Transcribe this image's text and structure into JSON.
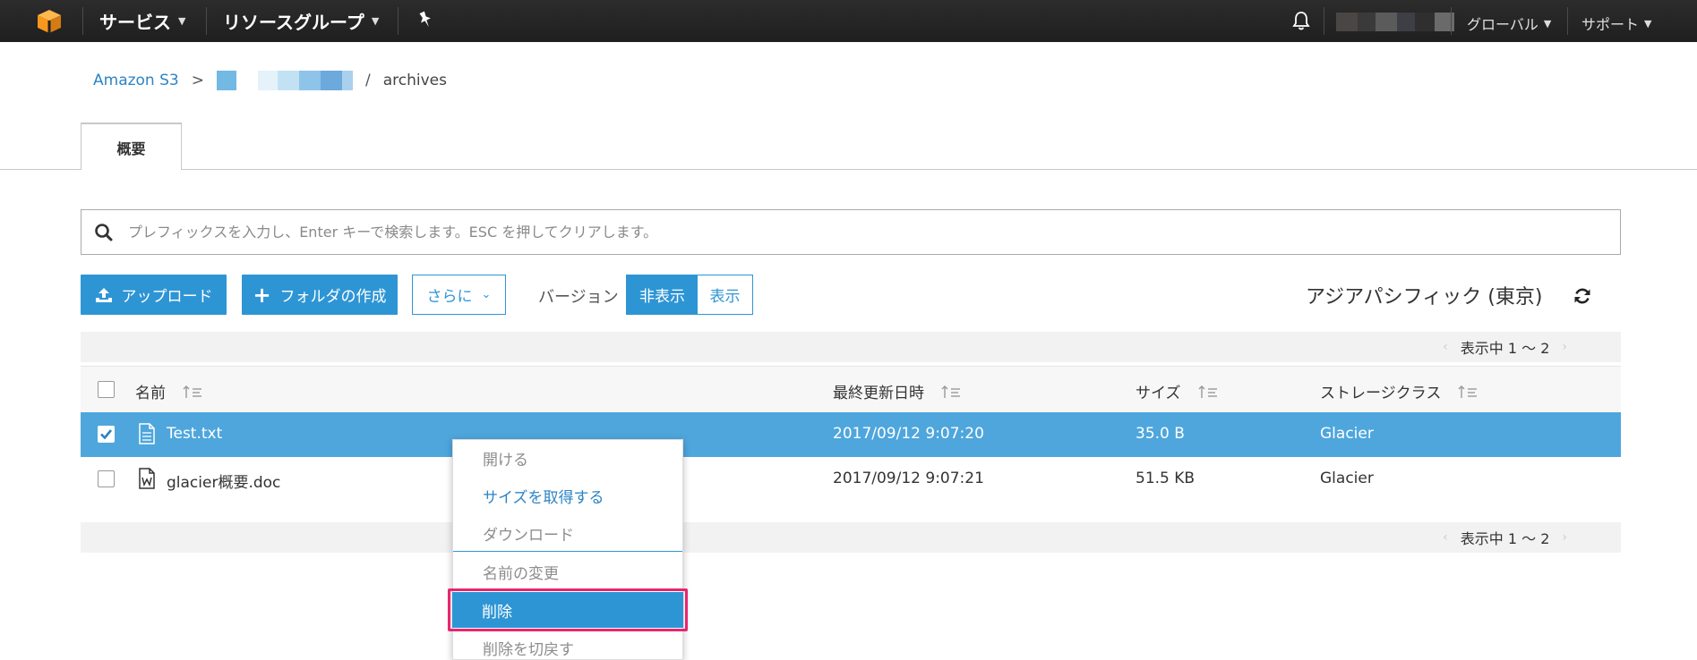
{
  "topbar": {
    "services_label": "サービス",
    "resource_groups_label": "リソースグループ",
    "region_menu_label": "グローバル",
    "support_menu_label": "サポート",
    "colors": {
      "bg": "#232f3e",
      "logo": "#f90"
    }
  },
  "breadcrumb": {
    "root": "Amazon S3",
    "separator": ">",
    "separator2": "/",
    "current": "archives"
  },
  "tabs": [
    {
      "label": "概要"
    }
  ],
  "search": {
    "placeholder": "プレフィックスを入力し、Enter キーで検索します。ESC を押してクリアします。"
  },
  "toolbar": {
    "upload_label": "アップロード",
    "create_folder_label": "フォルダの作成",
    "more_label": "さらに",
    "version_label": "バージョン",
    "version_hide": "非表示",
    "version_show": "表示",
    "region_name": "アジアパシフィック (東京)"
  },
  "table": {
    "pager_text": "表示中 1 ～ 2",
    "columns": {
      "name": "名前",
      "modified": "最終更新日時",
      "size": "サイズ",
      "storage": "ストレージクラス"
    },
    "rows": [
      {
        "name": "Test.txt",
        "modified": "2017/09/12 9:07:20",
        "size": "35.0 B",
        "storage": "Glacier",
        "selected": true
      },
      {
        "name": "glacier概要.doc",
        "modified": "2017/09/12 9:07:21",
        "size": "51.5 KB",
        "storage": "Glacier",
        "selected": false
      }
    ]
  },
  "context_menu": {
    "items": [
      {
        "label": "開ける"
      },
      {
        "label": "サイズを取得する"
      },
      {
        "label": "ダウンロード"
      },
      {
        "label": "名前の変更"
      },
      {
        "label": "削除"
      },
      {
        "label": "削除を切戻す"
      }
    ]
  },
  "colors": {
    "primary": "#2e95d5",
    "selected_row": "#4ea6dd",
    "highlight_border": "#e8266f",
    "link": "#2d84c5"
  }
}
